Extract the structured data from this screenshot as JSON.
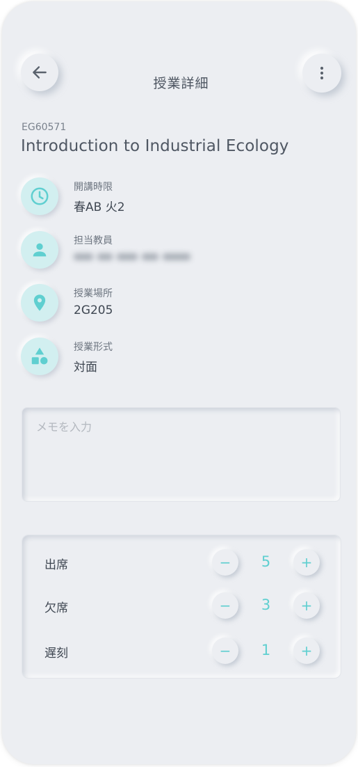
{
  "header": {
    "title": "授業詳細",
    "back_icon": "arrow-left-icon",
    "menu_icon": "more-vertical-icon"
  },
  "course": {
    "code": "EG60571",
    "title": "Introduction to Industrial Ecology"
  },
  "details": [
    {
      "icon": "clock-icon",
      "label": "開講時限",
      "value": "春AB 火2"
    },
    {
      "icon": "person-icon",
      "label": "担当教員",
      "value": ""
    },
    {
      "icon": "location-pin-icon",
      "label": "授業場所",
      "value": "2G205"
    },
    {
      "icon": "shapes-icon",
      "label": "授業形式",
      "value": "対面"
    }
  ],
  "memo": {
    "placeholder": "メモを入力"
  },
  "attendance": {
    "minus_symbol": "−",
    "plus_symbol": "+",
    "rows": [
      {
        "label": "出席",
        "count": "5"
      },
      {
        "label": "欠席",
        "count": "3"
      },
      {
        "label": "遅刻",
        "count": "1"
      }
    ]
  },
  "colors": {
    "accent": "#5fcfd0",
    "icon_bg": "#d2eff0",
    "surface": "#eceef2",
    "text": "#4d5561"
  }
}
